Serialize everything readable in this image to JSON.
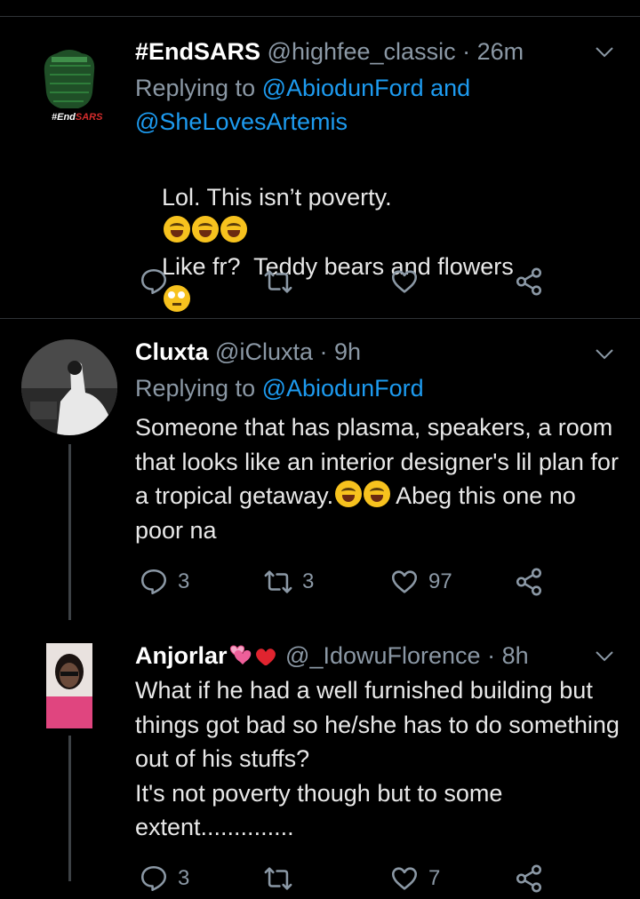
{
  "tweets": [
    {
      "name": "#EndSARS",
      "handle": "@highfee_classic",
      "sep": "·",
      "time": "26m",
      "reply_prefix": "Replying to",
      "reply_link1": "@AbiodunFord",
      "reply_mid": "and",
      "reply_link2": "@SheLovesArtemis",
      "body_line1": "Lol. This isn’t poverty.",
      "body_line2": "Like fr?  Teddy bears and flowers",
      "avatar_text": "#End",
      "avatar_text_red": "SARS",
      "emojis": [
        "rolling-on-floor-laughing",
        "rolling-on-floor-laughing",
        "rolling-on-floor-laughing",
        "face-with-rolling-eyes"
      ]
    },
    {
      "name": "Cluxta",
      "handle": "@iCluxta",
      "sep": "·",
      "time": "9h",
      "reply_prefix": "Replying to",
      "reply_link1": "@AbiodunFord",
      "body_text": "Someone that has plasma, speakers, a room that looks like an interior designer's lil plan for a tropical getaway.",
      "body_tail": " Abeg this one no poor na",
      "emojis": [
        "face-with-tears-of-joy",
        "face-with-tears-of-joy"
      ],
      "replies": "3",
      "retweets": "3",
      "likes": "97"
    },
    {
      "name": "Anjorlar",
      "name_emojis": [
        "two-hearts",
        "red-heart"
      ],
      "handle": "@_IdowuFlorence",
      "sep": "·",
      "time": "8h",
      "body": "What if he had a well furnished building but things got bad so he/she has to do something out of his stuffs?\nIt's not poverty though but to some extent..............",
      "replies": "3",
      "likes": "7"
    }
  ],
  "colors": {
    "background": "#000000",
    "link": "#1d9bf0",
    "muted": "#8b98a5",
    "divider": "#2f3336",
    "text": "#e8e8e8"
  },
  "icons": [
    "reply-icon",
    "retweet-icon",
    "like-icon",
    "share-icon",
    "chevron-down-icon"
  ]
}
